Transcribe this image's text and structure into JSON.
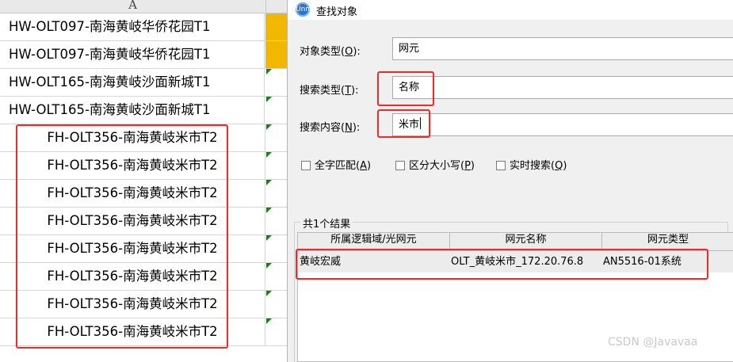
{
  "spreadsheet": {
    "column_header": "A",
    "rows": [
      {
        "text": "HW-OLT097-南海黄岐华侨花园T1",
        "b_fill": "yellow"
      },
      {
        "text": "HW-OLT097-南海黄岐华侨花园T1",
        "b_fill": "yellow"
      },
      {
        "text": "HW-OLT165-南海黄岐沙面新城T1",
        "b_fill": "none"
      },
      {
        "text": "HW-OLT165-南海黄岐沙面新城T1",
        "b_fill": "none"
      },
      {
        "text": "FH-OLT356-南海黄岐米市T2",
        "b_fill": "none"
      },
      {
        "text": "FH-OLT356-南海黄岐米市T2",
        "b_fill": "none"
      },
      {
        "text": "FH-OLT356-南海黄岐米市T2",
        "b_fill": "none"
      },
      {
        "text": "FH-OLT356-南海黄岐米市T2",
        "b_fill": "none"
      },
      {
        "text": "FH-OLT356-南海黄岐米市T2",
        "b_fill": "none"
      },
      {
        "text": "FH-OLT356-南海黄岐米市T2",
        "b_fill": "none"
      },
      {
        "text": "FH-OLT356-南海黄岐米市T2",
        "b_fill": "none"
      },
      {
        "text": "FH-OLT356-南海黄岐米市T2",
        "b_fill": "none"
      }
    ]
  },
  "dialog": {
    "title": "查找对象",
    "app_icon": "unm-icon",
    "app_icon_text": "Unm",
    "object_type_label": "对象类型(",
    "object_type_key": "O",
    "object_type_value": "网元",
    "search_type_label": "搜索类型(",
    "search_type_key": "T",
    "search_type_value": "名称",
    "search_content_label": "搜索内容(",
    "search_content_key": "N",
    "search_content_value": "米市",
    "label_close": "):",
    "options": [
      {
        "label": "全字匹配(",
        "key": "A",
        "checked": false
      },
      {
        "label": "区分大小写(",
        "key": "P",
        "checked": false
      },
      {
        "label": "实时搜索(",
        "key": "Q",
        "checked": false
      }
    ],
    "option_close": ")",
    "results_label": "共1个结果",
    "columns": [
      "所属逻辑域/光网元",
      "网元名称",
      "网元类型"
    ],
    "result_row": [
      "黄岐宏威",
      "OLT_黄岐米市_172.20.76.8",
      "AN5516-01系统"
    ]
  },
  "watermark": "CSDN @Javavaa",
  "colors": {
    "highlight": "#ee2b2b",
    "fill_yellow": "#f2b800",
    "comment_marker": "#1e7b1e"
  }
}
